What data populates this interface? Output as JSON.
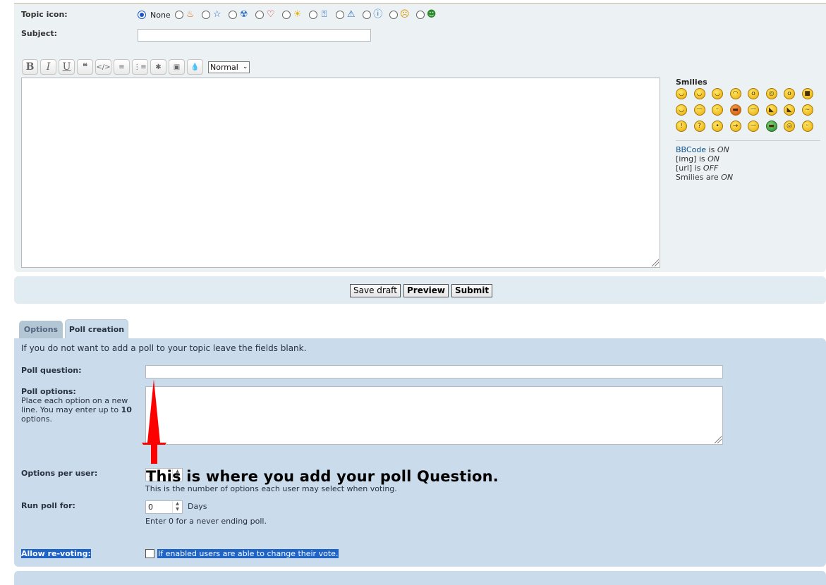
{
  "post": {
    "topic_icon_label": "Topic icon:",
    "none_label": "None",
    "topic_icons": [
      "fire-icon",
      "star-icon",
      "radioactive-icon",
      "heart-icon",
      "lightbulb-icon",
      "question-icon",
      "warning-icon",
      "info-icon",
      "surprised-face-icon",
      "grin-face-icon"
    ],
    "subject_label": "Subject:",
    "subject_value": ""
  },
  "toolbar": {
    "bold": "B",
    "italic": "I",
    "underline": "U",
    "quote": "❝",
    "code": "</>",
    "list": "≡",
    "list_numbered": "⋮≡",
    "list_item": "✱",
    "image": "▣",
    "color": "💧",
    "font_size": "Normal"
  },
  "smilies": {
    "title": "Smilies",
    "faces": [
      "😄",
      "😀",
      "😉",
      "😊",
      "😮",
      "😳",
      "😯",
      "😎",
      "😆",
      "😡",
      "😛",
      "😠",
      "😒",
      "😈",
      "😺",
      "😕",
      "!",
      "?",
      "💡",
      "→",
      "😐",
      "😁",
      "🤓",
      "😜"
    ]
  },
  "bbcode_info": {
    "bbcode_link": "BBCode",
    "bbcode_is": " is ",
    "bbcode_state": "ON",
    "img_label": "[img] is ",
    "img_state": "ON",
    "url_label": "[url] is ",
    "url_state": "OFF",
    "smilies_label": "Smilies are ",
    "smilies_state": "ON"
  },
  "buttons": {
    "save_draft": "Save draft",
    "preview": "Preview",
    "submit": "Submit"
  },
  "tabs": {
    "options": "Options",
    "poll_creation": "Poll creation"
  },
  "poll": {
    "intro": "If you do not want to add a poll to your topic leave the fields blank.",
    "question_label": "Poll question:",
    "question_value": "",
    "options_label": "Poll options:",
    "options_desc_1": "Place each option on a new line. You may enter up to ",
    "options_desc_max": "10",
    "options_desc_2": " options.",
    "options_per_user_label": "Options per user:",
    "options_per_user_value": "1",
    "options_per_user_help": "This is the number of options each user may select when voting.",
    "run_poll_label": "Run poll for:",
    "run_poll_value": "0",
    "run_poll_unit": "Days",
    "run_poll_help": "Enter 0 for a never ending poll.",
    "revote_label": "Allow re-voting:",
    "revote_help": "If enabled users are able to change their vote."
  },
  "annotation": {
    "text": "This is where you add your poll Question.",
    "arrow_color": "#ff0000"
  }
}
